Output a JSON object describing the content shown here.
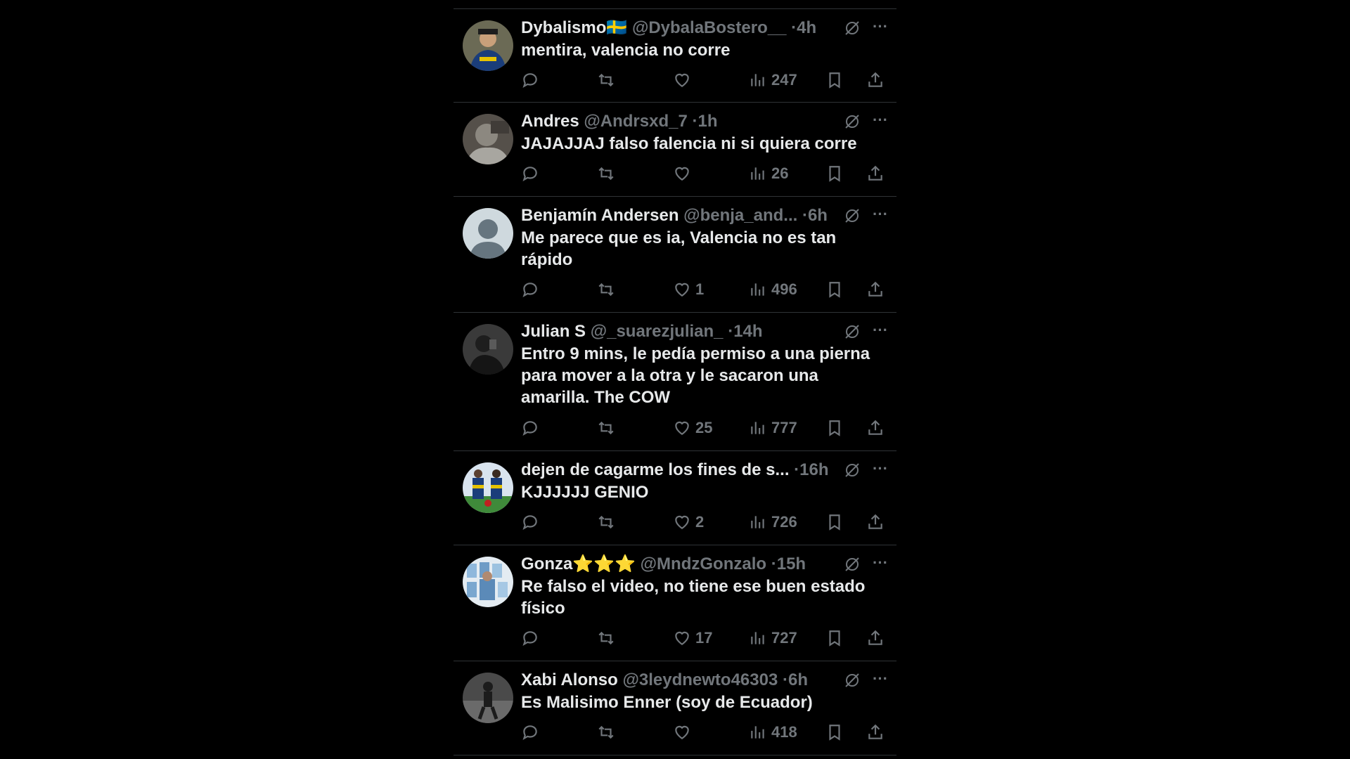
{
  "feed": {
    "tweets": [
      {
        "name": "Dybalismo🇸🇪",
        "handle": "@DybalaBostero__",
        "dot": "·",
        "time": "4h",
        "text": "mentira, valencia no corre",
        "likes": "",
        "views": "247",
        "avatar": "green-yellow-jersey"
      },
      {
        "name": "Andres",
        "handle": "@Andrsxd_7",
        "dot": "·",
        "time": "1h",
        "text": "JAJAJJAJ falso falencia ni si quiera corre",
        "likes": "",
        "views": "26",
        "avatar": "grey-photo"
      },
      {
        "name": "Benjamín Andersen",
        "handle": "@benja_and...",
        "dot": "·",
        "time": "6h",
        "text": "Me parece que es ia, Valencia no es tan rápido",
        "likes": "1",
        "views": "496",
        "avatar": "default-profile"
      },
      {
        "name": "Julian S",
        "handle": "@_suarezjulian_",
        "dot": "·",
        "time": "14h",
        "text": "Entro 9 mins, le pedía permiso a una pierna para mover a la otra y le sacaron una amarilla. The COW",
        "likes": "25",
        "views": "777",
        "avatar": "dark-photo"
      },
      {
        "name": "dejen de cagarme los fines de s...",
        "handle": "",
        "dot": "·",
        "time": "16h",
        "text": "KJJJJJJ GENIO",
        "likes": "2",
        "views": "726",
        "avatar": "football-team"
      },
      {
        "name": "Gonza⭐⭐⭐",
        "handle": "@MndzGonzalo",
        "dot": "·",
        "time": "15h",
        "text": "Re falso el video, no tiene ese buen estado físico",
        "likes": "17",
        "views": "727",
        "avatar": "sky-blue-collage"
      },
      {
        "name": "Xabi Alonso",
        "handle": "@3leydnewto46303",
        "dot": "·",
        "time": "6h",
        "text": "Es Malisimo Enner (soy de Ecuador)",
        "likes": "",
        "views": "418",
        "avatar": "bw-photo"
      }
    ],
    "colors": {
      "background": "#000000",
      "text": "#e7e9ea",
      "muted": "#71767b",
      "divider": "#2f3336"
    },
    "icons": [
      "reply-icon",
      "retweet-icon",
      "like-icon",
      "views-icon",
      "bookmark-icon",
      "share-icon",
      "grok-icon",
      "more-icon"
    ]
  }
}
